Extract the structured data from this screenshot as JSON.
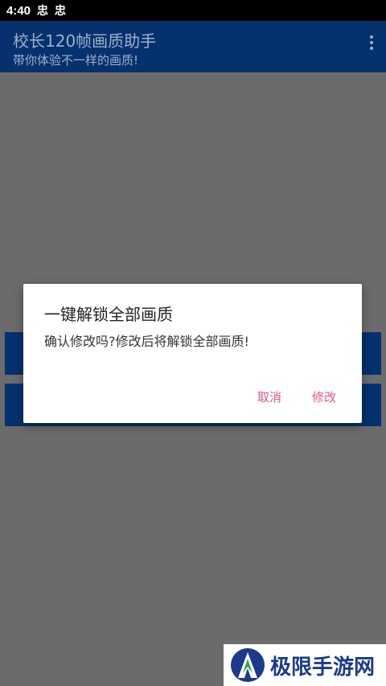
{
  "statusbar": {
    "time": "4:40",
    "icon1": "忠",
    "icon2": "忠"
  },
  "appbar": {
    "title": "校长120帧画质助手",
    "subtitle": "带你体验不一样的画质!"
  },
  "dialog": {
    "title": "一键解锁全部画质",
    "message": "确认修改吗?修改后将解锁全部画质!",
    "cancel_label": "取消",
    "confirm_label": "修改",
    "accent_color": "#e0568a"
  },
  "watermark": {
    "text": "极限手游网"
  }
}
